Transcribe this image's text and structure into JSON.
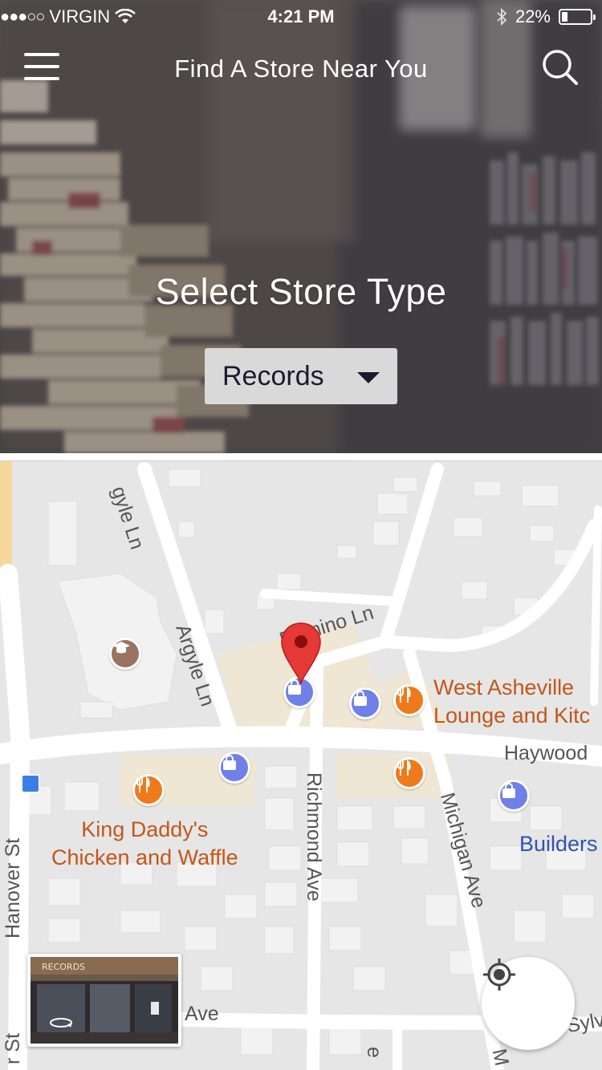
{
  "status_bar": {
    "signal_dots": "●●●○○",
    "carrier": "VIRGIN",
    "time": "4:21 PM",
    "battery_percent": "22%",
    "battery_level": 0.22
  },
  "header": {
    "title": "Find A Store Near You",
    "menu_icon": "hamburger-menu-icon",
    "search_icon": "search-icon"
  },
  "hero": {
    "heading": "Select Store Type",
    "store_type_selected": "Records"
  },
  "map": {
    "roads": {
      "argyle_top": "gyle Ln",
      "argyle": "Argyle Ln",
      "domino": "Domino Ln",
      "haywood": "Haywood",
      "richmond": "Richmond Ave",
      "michigan": "Michigan Ave",
      "hanover": "Hanover St",
      "bottom_ave": "Ave",
      "sylva": "Sylva",
      "left_st": "r St",
      "bottom_e": "e",
      "bottom_m": "M"
    },
    "pois": {
      "west_asheville_line1": "West Asheville",
      "west_asheville_line2": "Lounge and Kitc",
      "king_daddys_line1": "King Daddy's",
      "king_daddys_line2": "Chicken and Waffle",
      "builders": "Builders"
    },
    "streetview_text": "RECORDS",
    "locate_icon": "my-location-icon"
  },
  "colors": {
    "dropdown_bg": "#d9d9d9",
    "poi_text": "#c2571a",
    "shop_pin": "#6f80e8",
    "food_pin": "#ee7a1c",
    "marker_red": "#e53935"
  }
}
